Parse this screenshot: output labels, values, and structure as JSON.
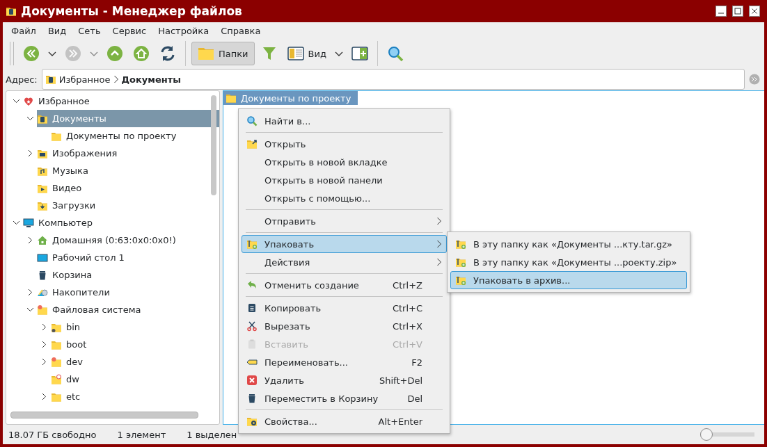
{
  "window": {
    "title": "Документы - Менеджер файлов"
  },
  "menu_bar": [
    "Файл",
    "Вид",
    "Сеть",
    "Сервис",
    "Настройка",
    "Справка"
  ],
  "toolbar": [
    {
      "kind": "back",
      "disabled": false
    },
    {
      "kind": "dropdown",
      "disabled": false
    },
    {
      "kind": "forward",
      "disabled": true
    },
    {
      "kind": "dropdown",
      "disabled": true
    },
    {
      "kind": "up",
      "disabled": false
    },
    {
      "kind": "home",
      "disabled": false
    },
    {
      "kind": "reload",
      "disabled": false
    },
    {
      "kind": "separator"
    },
    {
      "kind": "folders",
      "label": "Папки",
      "selected": true,
      "disabled": false
    },
    {
      "kind": "filter",
      "disabled": false
    },
    {
      "kind": "view",
      "label": "Вид",
      "disabled": false
    },
    {
      "kind": "dropdown",
      "disabled": false
    },
    {
      "kind": "split",
      "disabled": false
    },
    {
      "kind": "separator"
    },
    {
      "kind": "search",
      "disabled": false
    }
  ],
  "address": {
    "label": "Адрес:",
    "crumbs": [
      {
        "text": "Избранное",
        "current": false
      },
      {
        "text": "Документы",
        "current": true
      }
    ]
  },
  "tree": [
    {
      "label": "Избранное",
      "kind": "heart",
      "expanded": true,
      "selected": false,
      "children": [
        {
          "label": "Документы",
          "kind": "doc-folder",
          "expanded": true,
          "selected": true,
          "children": [
            {
              "label": "Документы по проекту",
              "kind": "folder",
              "selected": false
            }
          ]
        },
        {
          "label": "Изображения",
          "kind": "image-folder",
          "expanded": false,
          "selected": false
        },
        {
          "label": "Музыка",
          "kind": "music-folder",
          "selected": false
        },
        {
          "label": "Видео",
          "kind": "video-folder",
          "selected": false
        },
        {
          "label": "Загрузки",
          "kind": "download-folder",
          "selected": false
        }
      ]
    },
    {
      "label": "Компьютер",
      "kind": "monitor",
      "expanded": true,
      "selected": false,
      "children": [
        {
          "label": "Домашняя (0:63:0x0:0x0!)",
          "kind": "home",
          "expanded": false,
          "selected": false
        },
        {
          "label": "Рабочий стол 1",
          "kind": "desktop",
          "selected": false
        },
        {
          "label": "Корзина",
          "kind": "trash",
          "selected": false
        },
        {
          "label": "Накопители",
          "kind": "drives",
          "expanded": false,
          "selected": false
        },
        {
          "label": "Файловая система",
          "kind": "fs-folder",
          "expanded": true,
          "selected": false,
          "children": [
            {
              "label": "bin",
              "kind": "link-folder",
              "expanded": false,
              "selected": false
            },
            {
              "label": "boot",
              "kind": "folder",
              "expanded": false,
              "selected": false
            },
            {
              "label": "dev",
              "kind": "fs-folder",
              "expanded": false,
              "selected": false
            },
            {
              "label": "dw",
              "kind": "blocked-folder",
              "selected": false
            },
            {
              "label": "etc",
              "kind": "folder",
              "expanded": false,
              "selected": false
            }
          ]
        }
      ]
    }
  ],
  "files": [
    {
      "name": "Документы по проекту",
      "selected": true
    }
  ],
  "context_menu": [
    {
      "kind": "search",
      "label": "Найти в...",
      "submenu": false,
      "disabled": false,
      "selected": false
    },
    {
      "kind": "separator"
    },
    {
      "kind": "open",
      "label": "Открыть",
      "submenu": false,
      "disabled": false,
      "selected": false
    },
    {
      "kind": "plain",
      "label": "Открыть в новой вкладке",
      "submenu": false,
      "disabled": false,
      "selected": false
    },
    {
      "kind": "plain",
      "label": "Открыть в новой панели",
      "submenu": false,
      "disabled": false,
      "selected": false
    },
    {
      "kind": "plain",
      "label": "Открыть с помощью...",
      "submenu": false,
      "disabled": false,
      "selected": false
    },
    {
      "kind": "separator"
    },
    {
      "kind": "plain",
      "label": "Отправить",
      "submenu": true,
      "disabled": false,
      "selected": false
    },
    {
      "kind": "separator"
    },
    {
      "kind": "pack",
      "label": "Упаковать",
      "submenu": true,
      "disabled": false,
      "selected": true
    },
    {
      "kind": "plain",
      "label": "Действия",
      "submenu": true,
      "disabled": false,
      "selected": false
    },
    {
      "kind": "separator"
    },
    {
      "kind": "undo",
      "label": "Отменить создание",
      "shortcut": "Ctrl+Z",
      "submenu": false,
      "disabled": false,
      "selected": false
    },
    {
      "kind": "separator"
    },
    {
      "kind": "copy",
      "label": "Копировать",
      "shortcut": "Ctrl+C",
      "submenu": false,
      "disabled": false,
      "selected": false
    },
    {
      "kind": "cut",
      "label": "Вырезать",
      "shortcut": "Ctrl+X",
      "submenu": false,
      "disabled": false,
      "selected": false
    },
    {
      "kind": "paste",
      "label": "Вставить",
      "shortcut": "Ctrl+V",
      "submenu": false,
      "disabled": true,
      "selected": false
    },
    {
      "kind": "rename",
      "label": "Переименовать...",
      "shortcut": "F2",
      "submenu": false,
      "disabled": false,
      "selected": false
    },
    {
      "kind": "delete",
      "label": "Удалить",
      "shortcut": "Shift+Del",
      "submenu": false,
      "disabled": false,
      "selected": false
    },
    {
      "kind": "trashcan",
      "label": "Переместить в Корзину",
      "shortcut": "Del",
      "submenu": false,
      "disabled": false,
      "selected": false
    },
    {
      "kind": "separator"
    },
    {
      "kind": "properties",
      "label": "Свойства...",
      "shortcut": "Alt+Enter",
      "submenu": false,
      "disabled": false,
      "selected": false
    }
  ],
  "submenu": [
    {
      "label": "В эту папку как «Документы ...кту.tar.gz»",
      "selected": false
    },
    {
      "label": "В эту папку как «Документы ...роекту.zip»",
      "selected": false
    },
    {
      "label": "Упаковать в архив...",
      "selected": true
    }
  ],
  "status_bar": {
    "free": "18.07 ГБ свободно",
    "count": "1 элемент",
    "selected": "1 выделен",
    "zoom": {
      "level": 0
    }
  }
}
